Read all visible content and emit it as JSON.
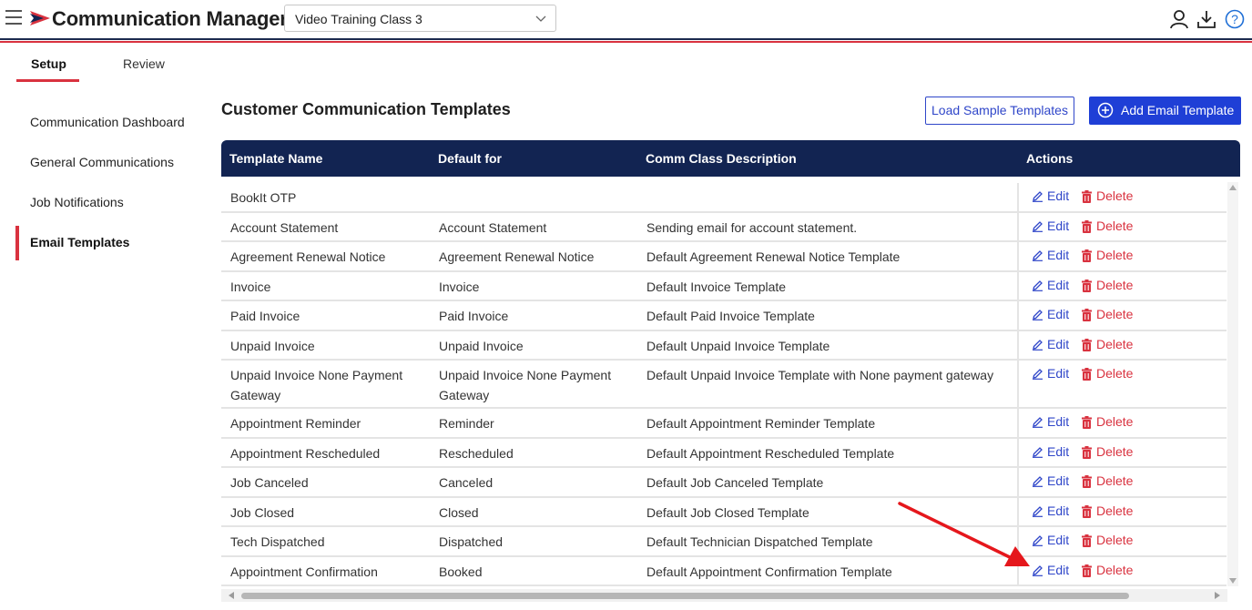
{
  "header": {
    "app_title": "Communication Manager",
    "selected_class": "Video Training Class 3",
    "icons": [
      "menu-icon",
      "user-icon",
      "download-icon",
      "help-icon"
    ],
    "brand_colors": {
      "navy": "#122452",
      "red": "#d9323f",
      "blue": "#1f3fd6"
    }
  },
  "tabs": [
    {
      "label": "Setup",
      "active": true
    },
    {
      "label": "Review",
      "active": false
    }
  ],
  "sidebar": {
    "items": [
      {
        "label": "Communication Dashboard",
        "active": false
      },
      {
        "label": "General Communications",
        "active": false
      },
      {
        "label": "Job Notifications",
        "active": false
      },
      {
        "label": "Email Templates",
        "active": true
      }
    ]
  },
  "main": {
    "title": "Customer Communication Templates",
    "load_button": "Load Sample Templates",
    "add_button": "Add Email Template"
  },
  "table": {
    "columns": [
      "Template Name",
      "Default for",
      "Comm Class Description",
      "Actions"
    ],
    "edit_label": "Edit",
    "delete_label": "Delete",
    "rows": [
      {
        "name": "BookIt OTP",
        "default_for": "",
        "description": ""
      },
      {
        "name": "Account Statement",
        "default_for": "Account Statement",
        "description": "Sending email for account statement."
      },
      {
        "name": "Agreement Renewal Notice",
        "default_for": "Agreement Renewal Notice",
        "description": "Default Agreement Renewal Notice Template"
      },
      {
        "name": "Invoice",
        "default_for": "Invoice",
        "description": "Default Invoice Template"
      },
      {
        "name": "Paid Invoice",
        "default_for": "Paid Invoice",
        "description": "Default Paid Invoice Template"
      },
      {
        "name": "Unpaid Invoice",
        "default_for": "Unpaid Invoice",
        "description": "Default Unpaid Invoice Template"
      },
      {
        "name": "Unpaid Invoice None Payment Gateway",
        "default_for": "Unpaid Invoice None Payment Gateway",
        "description": "Default Unpaid Invoice Template with None payment gateway"
      },
      {
        "name": "Appointment Reminder",
        "default_for": "Reminder",
        "description": "Default Appointment Reminder Template"
      },
      {
        "name": "Appointment Rescheduled",
        "default_for": "Rescheduled",
        "description": "Default Appointment Rescheduled Template"
      },
      {
        "name": "Job Canceled",
        "default_for": "Canceled",
        "description": "Default Job Canceled Template"
      },
      {
        "name": "Job Closed",
        "default_for": "Closed",
        "description": "Default Job Closed Template"
      },
      {
        "name": "Tech Dispatched",
        "default_for": "Dispatched",
        "description": "Default Technician Dispatched Template"
      },
      {
        "name": "Appointment Confirmation",
        "default_for": "Booked",
        "description": "Default Appointment Confirmation Template"
      }
    ]
  }
}
